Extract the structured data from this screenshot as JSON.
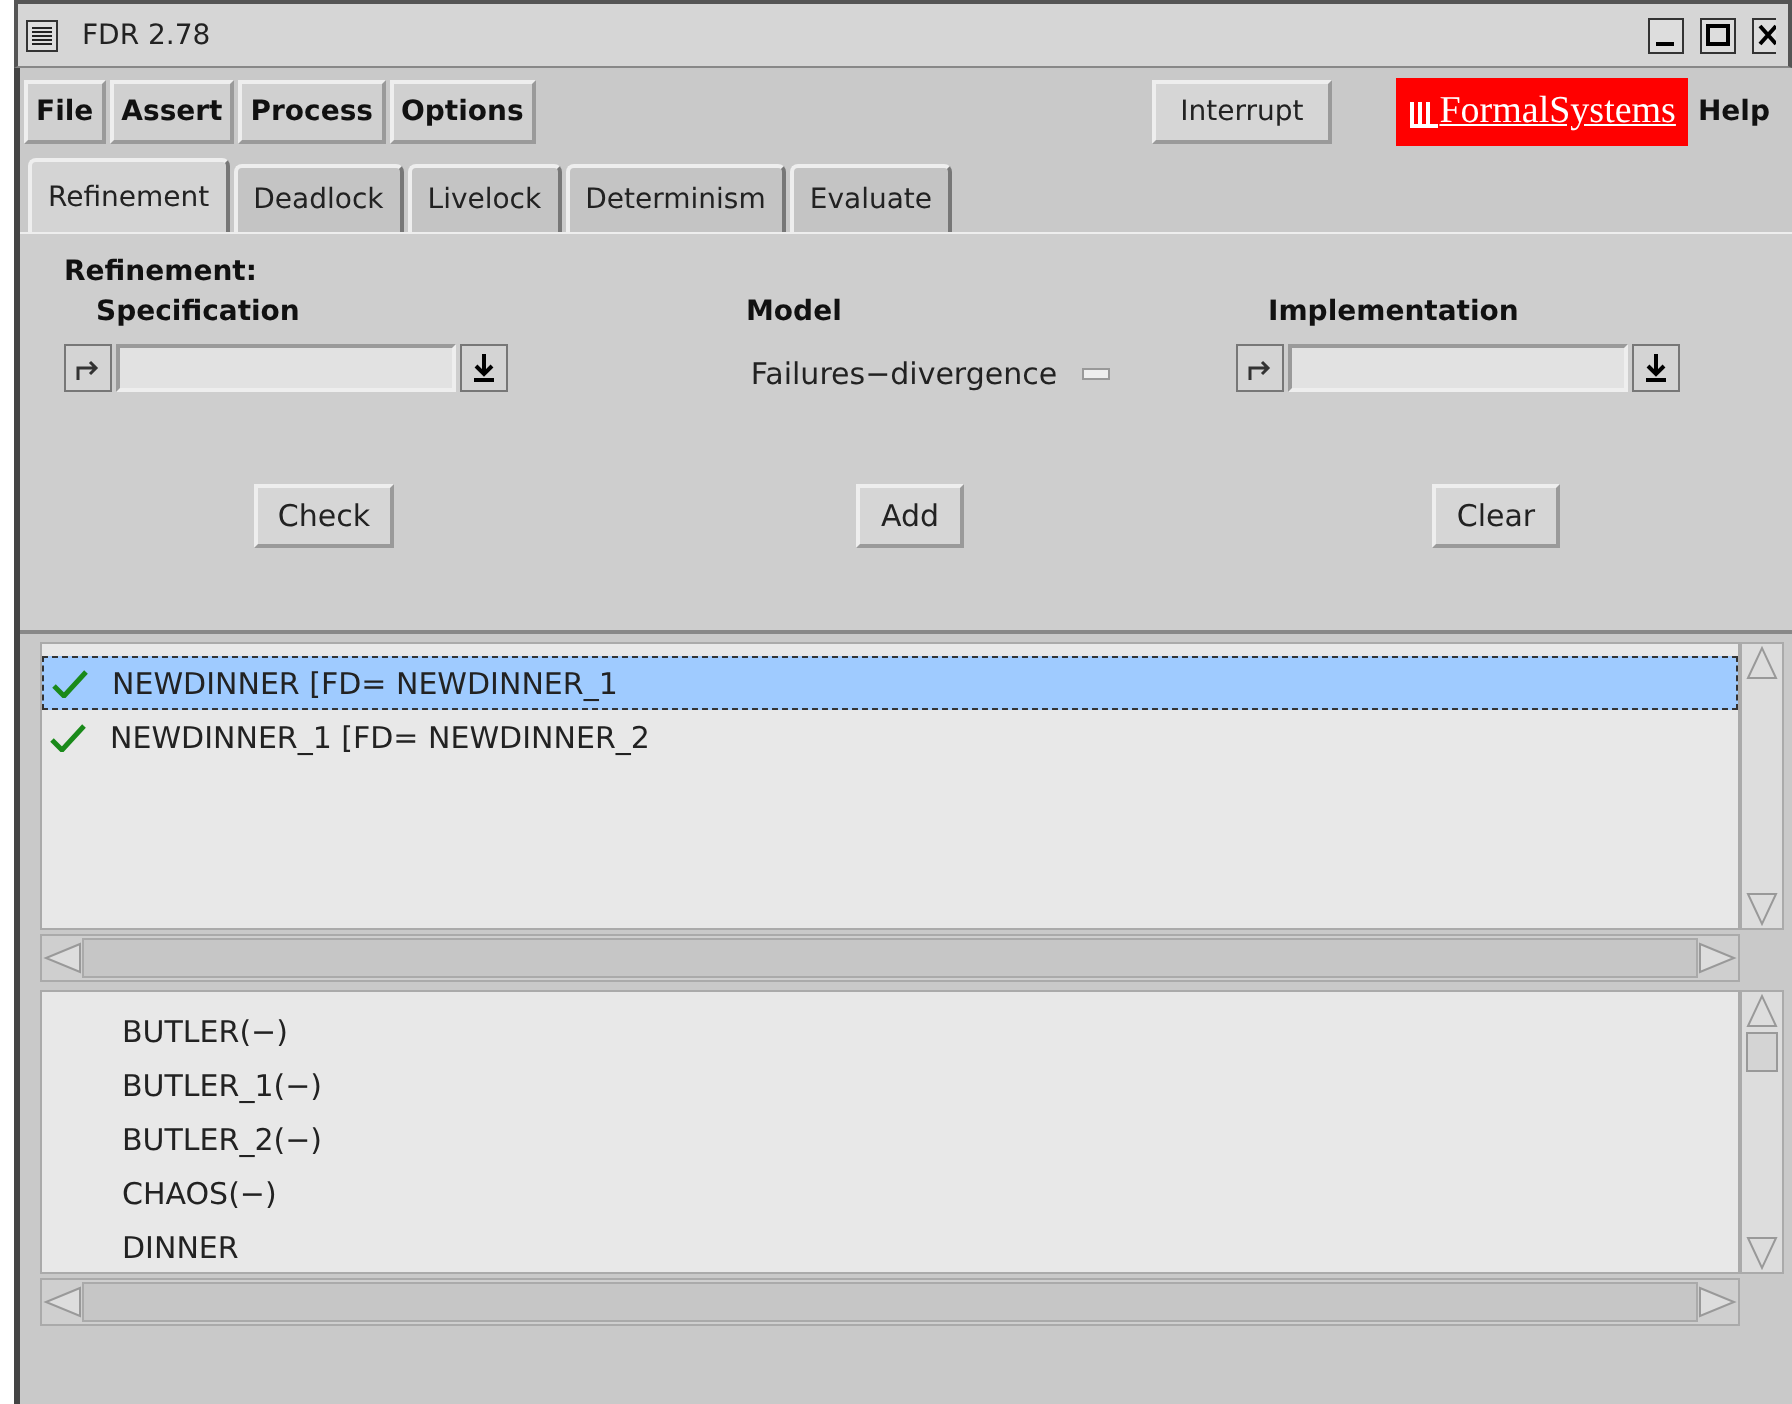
{
  "window": {
    "title": "FDR 2.78"
  },
  "menu": [
    {
      "label": "File"
    },
    {
      "label": "Assert"
    },
    {
      "label": "Process"
    },
    {
      "label": "Options"
    }
  ],
  "interrupt_button": "Interrupt",
  "logo": "FormalSystems",
  "help_menu": "Help",
  "tabs": [
    {
      "label": "Refinement",
      "selected": true
    },
    {
      "label": "Deadlock",
      "selected": false
    },
    {
      "label": "Livelock",
      "selected": false
    },
    {
      "label": "Determinism",
      "selected": false
    },
    {
      "label": "Evaluate",
      "selected": false
    }
  ],
  "refinement": {
    "heading": "Refinement:",
    "specification_label": "Specification",
    "model_label": "Model",
    "model_value": "Failures−divergence",
    "implementation_label": "Implementation",
    "buttons": [
      "Check",
      "Add",
      "Clear"
    ]
  },
  "assertions": [
    {
      "text": "NEWDINNER [FD= NEWDINNER_1",
      "passed": true,
      "selected": true
    },
    {
      "text": "NEWDINNER_1 [FD= NEWDINNER_2",
      "passed": true,
      "selected": false
    }
  ],
  "processes": [
    "BUTLER(−)",
    "BUTLER_1(−)",
    "BUTLER_2(−)",
    "CHAOS(−)",
    "DINNER"
  ]
}
